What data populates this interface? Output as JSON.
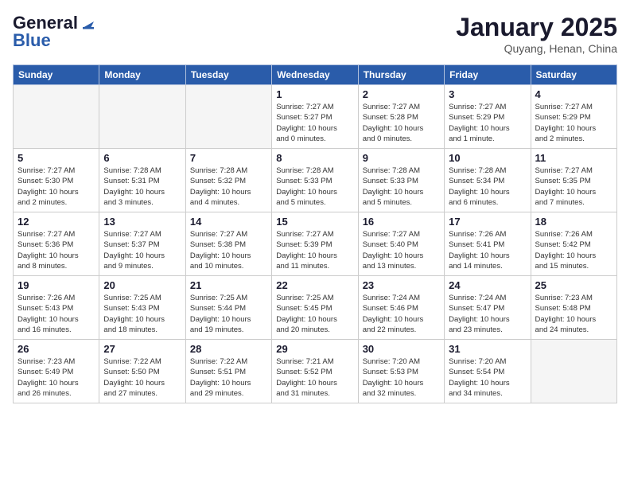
{
  "header": {
    "logo_general": "General",
    "logo_blue": "Blue",
    "month": "January 2025",
    "location": "Quyang, Henan, China"
  },
  "days_of_week": [
    "Sunday",
    "Monday",
    "Tuesday",
    "Wednesday",
    "Thursday",
    "Friday",
    "Saturday"
  ],
  "weeks": [
    [
      {
        "day": "",
        "info": ""
      },
      {
        "day": "",
        "info": ""
      },
      {
        "day": "",
        "info": ""
      },
      {
        "day": "1",
        "info": "Sunrise: 7:27 AM\nSunset: 5:27 PM\nDaylight: 10 hours\nand 0 minutes."
      },
      {
        "day": "2",
        "info": "Sunrise: 7:27 AM\nSunset: 5:28 PM\nDaylight: 10 hours\nand 0 minutes."
      },
      {
        "day": "3",
        "info": "Sunrise: 7:27 AM\nSunset: 5:29 PM\nDaylight: 10 hours\nand 1 minute."
      },
      {
        "day": "4",
        "info": "Sunrise: 7:27 AM\nSunset: 5:29 PM\nDaylight: 10 hours\nand 2 minutes."
      }
    ],
    [
      {
        "day": "5",
        "info": "Sunrise: 7:27 AM\nSunset: 5:30 PM\nDaylight: 10 hours\nand 2 minutes."
      },
      {
        "day": "6",
        "info": "Sunrise: 7:28 AM\nSunset: 5:31 PM\nDaylight: 10 hours\nand 3 minutes."
      },
      {
        "day": "7",
        "info": "Sunrise: 7:28 AM\nSunset: 5:32 PM\nDaylight: 10 hours\nand 4 minutes."
      },
      {
        "day": "8",
        "info": "Sunrise: 7:28 AM\nSunset: 5:33 PM\nDaylight: 10 hours\nand 5 minutes."
      },
      {
        "day": "9",
        "info": "Sunrise: 7:28 AM\nSunset: 5:33 PM\nDaylight: 10 hours\nand 5 minutes."
      },
      {
        "day": "10",
        "info": "Sunrise: 7:28 AM\nSunset: 5:34 PM\nDaylight: 10 hours\nand 6 minutes."
      },
      {
        "day": "11",
        "info": "Sunrise: 7:27 AM\nSunset: 5:35 PM\nDaylight: 10 hours\nand 7 minutes."
      }
    ],
    [
      {
        "day": "12",
        "info": "Sunrise: 7:27 AM\nSunset: 5:36 PM\nDaylight: 10 hours\nand 8 minutes."
      },
      {
        "day": "13",
        "info": "Sunrise: 7:27 AM\nSunset: 5:37 PM\nDaylight: 10 hours\nand 9 minutes."
      },
      {
        "day": "14",
        "info": "Sunrise: 7:27 AM\nSunset: 5:38 PM\nDaylight: 10 hours\nand 10 minutes."
      },
      {
        "day": "15",
        "info": "Sunrise: 7:27 AM\nSunset: 5:39 PM\nDaylight: 10 hours\nand 11 minutes."
      },
      {
        "day": "16",
        "info": "Sunrise: 7:27 AM\nSunset: 5:40 PM\nDaylight: 10 hours\nand 13 minutes."
      },
      {
        "day": "17",
        "info": "Sunrise: 7:26 AM\nSunset: 5:41 PM\nDaylight: 10 hours\nand 14 minutes."
      },
      {
        "day": "18",
        "info": "Sunrise: 7:26 AM\nSunset: 5:42 PM\nDaylight: 10 hours\nand 15 minutes."
      }
    ],
    [
      {
        "day": "19",
        "info": "Sunrise: 7:26 AM\nSunset: 5:43 PM\nDaylight: 10 hours\nand 16 minutes."
      },
      {
        "day": "20",
        "info": "Sunrise: 7:25 AM\nSunset: 5:43 PM\nDaylight: 10 hours\nand 18 minutes."
      },
      {
        "day": "21",
        "info": "Sunrise: 7:25 AM\nSunset: 5:44 PM\nDaylight: 10 hours\nand 19 minutes."
      },
      {
        "day": "22",
        "info": "Sunrise: 7:25 AM\nSunset: 5:45 PM\nDaylight: 10 hours\nand 20 minutes."
      },
      {
        "day": "23",
        "info": "Sunrise: 7:24 AM\nSunset: 5:46 PM\nDaylight: 10 hours\nand 22 minutes."
      },
      {
        "day": "24",
        "info": "Sunrise: 7:24 AM\nSunset: 5:47 PM\nDaylight: 10 hours\nand 23 minutes."
      },
      {
        "day": "25",
        "info": "Sunrise: 7:23 AM\nSunset: 5:48 PM\nDaylight: 10 hours\nand 24 minutes."
      }
    ],
    [
      {
        "day": "26",
        "info": "Sunrise: 7:23 AM\nSunset: 5:49 PM\nDaylight: 10 hours\nand 26 minutes."
      },
      {
        "day": "27",
        "info": "Sunrise: 7:22 AM\nSunset: 5:50 PM\nDaylight: 10 hours\nand 27 minutes."
      },
      {
        "day": "28",
        "info": "Sunrise: 7:22 AM\nSunset: 5:51 PM\nDaylight: 10 hours\nand 29 minutes."
      },
      {
        "day": "29",
        "info": "Sunrise: 7:21 AM\nSunset: 5:52 PM\nDaylight: 10 hours\nand 31 minutes."
      },
      {
        "day": "30",
        "info": "Sunrise: 7:20 AM\nSunset: 5:53 PM\nDaylight: 10 hours\nand 32 minutes."
      },
      {
        "day": "31",
        "info": "Sunrise: 7:20 AM\nSunset: 5:54 PM\nDaylight: 10 hours\nand 34 minutes."
      },
      {
        "day": "",
        "info": ""
      }
    ]
  ]
}
